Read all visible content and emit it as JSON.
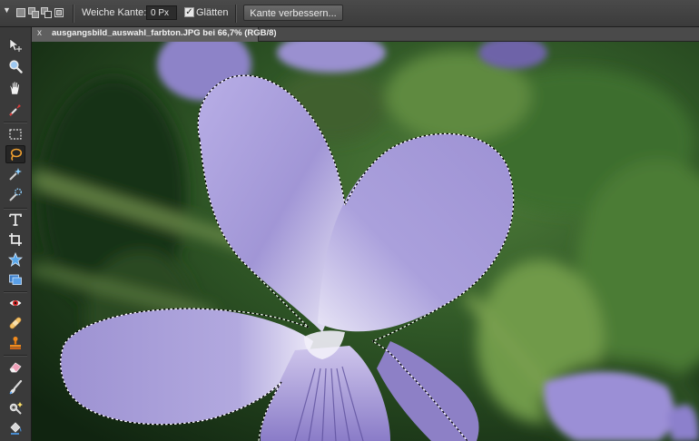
{
  "options_bar": {
    "feather_label": "Weiche Kante:",
    "feather_value": "0 Px",
    "smooth_label": "Glätten",
    "smooth_checked": true,
    "refine_edge_label": "Kante verbessern..."
  },
  "document_tab": {
    "close_glyph": "x",
    "title": "ausgangsbild_auswahl_farbton.JPG bei 66,7% (RGB/8)"
  },
  "toolbar": {
    "tools": [
      "move-icon",
      "zoom-icon",
      "hand-icon",
      "eyedropper-icon",
      "rectangular-marquee-icon",
      "lasso-icon",
      "magic-wand-icon",
      "quick-selection-icon",
      "type-icon",
      "crop-icon",
      "custom-shape-icon",
      "recompose-icon",
      "red-eye-icon",
      "healing-brush-icon",
      "clone-stamp-icon",
      "eraser-icon",
      "brush-icon",
      "smart-brush-icon",
      "paint-bucket-icon"
    ],
    "active_tool": "lasso-icon"
  }
}
